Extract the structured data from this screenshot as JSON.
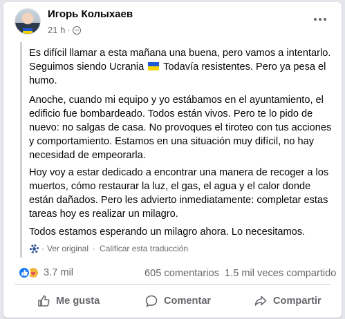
{
  "post": {
    "author": "Игорь Колыхаев",
    "time": "21 h",
    "time_separator": "·",
    "paragraphs": {
      "p1_before_flag": "Es difícil llamar a esta mañana una buena, pero vamos a intentarlo. Seguimos siendo Ucrania",
      "p1_after_flag": "Todavía resistentes. Pero ya pesa el humo.",
      "p2": "Anoche, cuando mi equipo y yo estábamos en el ayuntamiento, el edificio fue bombardeado. Todos están vivos. Pero te lo pido de nuevo: no salgas de casa. No provoques el tiroteo con tus acciones y comportamiento. Estamos en una situación muy difícil, no hay necesidad de empeorarla.",
      "p3": "Hoy voy a estar dedicado a encontrar una manera de recoger a los muertos, cómo restaurar la luz, el gas, el agua y el calor donde están dañados. Pero les advierto inmediatamente: completar estas tareas hoy es realizar un milagro.",
      "p4": "Todos estamos esperando un milagro ahora. Lo necesitamos."
    },
    "translation": {
      "view_original": "Ver original",
      "separator": "·",
      "rate": "Calificar esta traducción"
    }
  },
  "stats": {
    "reactions": "3.7 mil",
    "comments": "605 comentarios",
    "shares": "1.5 mil veces compartido"
  },
  "actions": {
    "like": "Me gusta",
    "comment": "Comentar",
    "share": "Compartir"
  },
  "colors": {
    "flag_blue": "#1f5bd6",
    "flag_yellow": "#f5d400",
    "like_blue": "#1877f2",
    "secondary_text": "#65676b"
  }
}
